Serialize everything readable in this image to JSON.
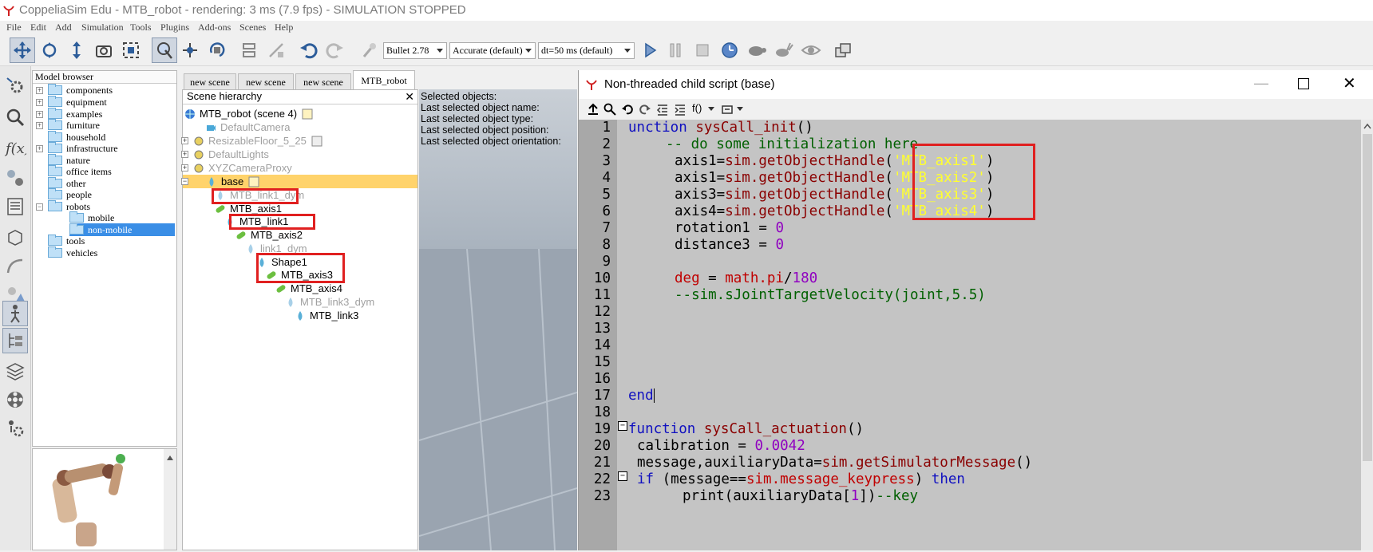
{
  "app": {
    "title": "CoppeliaSim Edu - MTB_robot - rendering: 3 ms (7.9 fps) - SIMULATION STOPPED"
  },
  "menu": [
    "File",
    "Edit",
    "Add",
    "Simulation",
    "Tools",
    "Plugins",
    "Add-ons",
    "Scenes",
    "Help"
  ],
  "toolbar": {
    "engine": "Bullet 2.78",
    "accuracy": "Accurate (default)",
    "timestep": "dt=50 ms (default)"
  },
  "model_browser": {
    "header": "Model browser",
    "items": [
      {
        "label": "components",
        "expander": "+"
      },
      {
        "label": "equipment",
        "expander": "+"
      },
      {
        "label": "examples",
        "expander": "+"
      },
      {
        "label": "furniture",
        "expander": "+"
      },
      {
        "label": "household",
        "expander": ""
      },
      {
        "label": "infrastructure",
        "expander": "+"
      },
      {
        "label": "nature",
        "expander": ""
      },
      {
        "label": "office items",
        "expander": ""
      },
      {
        "label": "other",
        "expander": ""
      },
      {
        "label": "people",
        "expander": ""
      },
      {
        "label": "robots",
        "expander": "−"
      },
      {
        "label": "mobile",
        "expander": ""
      },
      {
        "label": "non-mobile",
        "expander": ""
      },
      {
        "label": "tools",
        "expander": ""
      },
      {
        "label": "vehicles",
        "expander": ""
      }
    ]
  },
  "scene_tabs": [
    "new scene",
    "new scene",
    "new scene",
    "MTB_robot"
  ],
  "hierarchy": {
    "header": "Scene hierarchy",
    "items": [
      "MTB_robot (scene 4)",
      "DefaultCamera",
      "ResizableFloor_5_25",
      "DefaultLights",
      "XYZCameraProxy",
      "base",
      "MTB_link1_dym",
      "MTB_axis1",
      "MTB_link1",
      "MTB_axis2",
      "link1_dym",
      "Shape1",
      "MTB_axis3",
      "MTB_axis4",
      "MTB_link3_dym",
      "MTB_link3"
    ]
  },
  "viewport_info": [
    "Selected objects:",
    "Last selected object name:",
    "Last selected object type:",
    "Last selected object position:",
    "Last selected object orientation:"
  ],
  "script_window": {
    "title": "Non-threaded child script (base)",
    "fx_label": "f()",
    "line_numbers": [
      "1",
      "2",
      "3",
      "4",
      "5",
      "6",
      "7",
      "8",
      "9",
      "10",
      "11",
      "12",
      "13",
      "14",
      "15",
      "16",
      "17",
      "18",
      "19",
      "20",
      "21",
      "22",
      "23"
    ]
  },
  "code": {
    "l1_kw": "unction",
    "l1_fn": "sysCall_init",
    "l1_rest": "()",
    "l2": "-- do some initialization here",
    "l3_a": "axis1=",
    "l3_b": "sim.getObjectHandle",
    "l3_s": "'MTB_axis1'",
    "l4_a": "axis1=",
    "l4_b": "sim.getObjectHandle",
    "l4_s": "'MTB_axis2'",
    "l5_a": "axis3=",
    "l5_b": "sim.getObjectHandle",
    "l5_s": "'MTB_axis3'",
    "l6_a": "axis4=",
    "l6_b": "sim.getObjectHandle",
    "l6_s": "'MTB_axis4'",
    "l7_a": "rotation1 = ",
    "l7_n": "0",
    "l8_a": "distance3 = ",
    "l8_n": "0",
    "l10_a": "deg",
    "l10_b": " = ",
    "l10_c": "math.pi",
    "l10_d": "/",
    "l10_n": "180",
    "l11": "--sim.sJointTargetVelocity(joint,5.5)",
    "l17": "end",
    "l19_kw": "function",
    "l19_fn": "sysCall_actuation",
    "l19_rest": "()",
    "l20_a": "calibration = ",
    "l20_n": "0.0042",
    "l21_a": "message,auxiliaryData=",
    "l21_b": "sim.getSimulatorMessage",
    "l21_c": "()",
    "l22_kw": "if",
    "l22_a": " (message==",
    "l22_b": "sim.message_keypress",
    "l22_c": ") ",
    "l22_kw2": "then",
    "l23_a": "print",
    "l23_b": "(auxiliaryData[",
    "l23_n": "1",
    "l23_c": "])",
    "l23_d": "--key"
  },
  "colors": {
    "highlight_box": "#e02020",
    "selected_row": "#ffd36b",
    "editor_bg": "#c4c4c4",
    "string": "#ffff30"
  }
}
